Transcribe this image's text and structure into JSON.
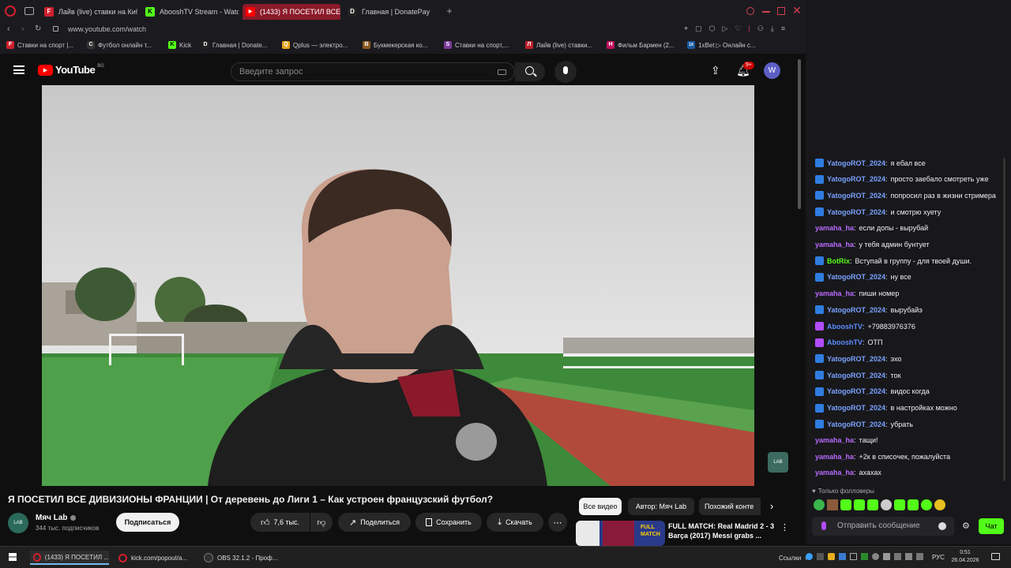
{
  "browser": {
    "tabs": [
      {
        "label": "Лайв (live) ставки на Киб",
        "icon_color": "#d0202e",
        "icon_text": "F"
      },
      {
        "label": "AbooshTV Stream - Watch",
        "icon_color": "#53fc18",
        "icon_text": "K"
      },
      {
        "label": "(1433) Я ПОСЕТИЛ ВСЕ Д",
        "icon_color": "#ff0000",
        "icon_text": "▶"
      },
      {
        "label": "Главная | DonatePay",
        "icon_color": "#222",
        "icon_text": "D"
      }
    ],
    "url": "www.youtube.com/watch",
    "bookmarks": [
      {
        "label": "Ставки на спорт |...",
        "color": "#d0202e",
        "text": "F"
      },
      {
        "label": "Футбол онлайн т...",
        "color": "#333",
        "text": "C"
      },
      {
        "label": "Kick",
        "color": "#53fc18",
        "text": "K"
      },
      {
        "label": "Главная | Donate...",
        "color": "#222",
        "text": "D"
      },
      {
        "label": "Qplus — электро...",
        "color": "#e8a21a",
        "text": "Q"
      },
      {
        "label": "Букмекерская ко...",
        "color": "#8a5a20",
        "text": "B"
      },
      {
        "label": "Ставки на спорт,...",
        "color": "#7a3a9a",
        "text": "S"
      },
      {
        "label": "Лайв (live) ставки...",
        "color": "#c0202e",
        "text": "Л"
      },
      {
        "label": "Фильм Бармен (2...",
        "color": "#c01060",
        "text": "H"
      },
      {
        "label": "1xBet ▷ Онлайн с...",
        "color": "#1a5aa0",
        "text": "1X"
      }
    ]
  },
  "youtube": {
    "logo": "YouTube",
    "region": "BG",
    "search_placeholder": "Введите запрос",
    "notifications": "9+",
    "avatar_letter": "W",
    "video_title": "Я ПОСЕТИЛ ВСЕ ДИВИЗИОНЫ ФРАНЦИИ | От деревень до Лиги 1 – Как устроен французский футбол?",
    "channel": "Мяч Lab",
    "channel_logo": "LAB",
    "subscribers": "344 тыс. подписчиков",
    "subscribe": "Подписаться",
    "likes": "7,6 тыс.",
    "share": "Поделиться",
    "save": "Сохранить",
    "download": "Скачать",
    "chips": [
      "Все видео",
      "Автор: Мяч Lab",
      "Похожий конте"
    ],
    "rec_title_1": "FULL MATCH: Real Madrid 2 - 3",
    "rec_title_2": "Barça (2017) Messi grabs ...",
    "rec_thumb_text": "FULL MATCH"
  },
  "chat": {
    "messages": [
      {
        "user": "YatogoROT_2024",
        "text": "я ебал все",
        "color": "#7aa2ff",
        "badge": "#2f7de1"
      },
      {
        "user": "YatogoROT_2024",
        "text": "просто заебало смотреть уже",
        "color": "#7aa2ff",
        "badge": "#2f7de1"
      },
      {
        "user": "YatogoROT_2024",
        "text": "попросил раз в жизни стримера",
        "color": "#7aa2ff",
        "badge": "#2f7de1"
      },
      {
        "user": "YatogoROT_2024",
        "text": "и смотрю хуету",
        "color": "#7aa2ff",
        "badge": "#2f7de1"
      },
      {
        "user": "yamaha_ha",
        "text": "если допы - вырубай",
        "color": "#b86bff",
        "badge": ""
      },
      {
        "user": "yamaha_ha",
        "text": "у тебя админ бунтует",
        "color": "#b86bff",
        "badge": ""
      },
      {
        "user": "BotRix",
        "text": "Вступай в группу - для твоей души.",
        "color": "#53fc18",
        "badge": "#2f7de1"
      },
      {
        "user": "YatogoROT_2024",
        "text": "ну все",
        "color": "#7aa2ff",
        "badge": "#2f7de1"
      },
      {
        "user": "yamaha_ha",
        "text": "пиши номер",
        "color": "#b86bff",
        "badge": ""
      },
      {
        "user": "YatogoROT_2024",
        "text": "вырубайэ",
        "color": "#7aa2ff",
        "badge": "#2f7de1"
      },
      {
        "user": "AbooshTV",
        "text": "+79883976376",
        "color": "#5a8cff",
        "badge": "#b24cff"
      },
      {
        "user": "AbooshTV",
        "text": "ОТП",
        "color": "#5a8cff",
        "badge": "#b24cff"
      },
      {
        "user": "YatogoROT_2024",
        "text": "эхо",
        "color": "#7aa2ff",
        "badge": "#2f7de1"
      },
      {
        "user": "YatogoROT_2024",
        "text": "ток",
        "color": "#7aa2ff",
        "badge": "#2f7de1"
      },
      {
        "user": "YatogoROT_2024",
        "text": "видос когда",
        "color": "#7aa2ff",
        "badge": "#2f7de1"
      },
      {
        "user": "YatogoROT_2024",
        "text": "в настройках можно",
        "color": "#7aa2ff",
        "badge": "#2f7de1"
      },
      {
        "user": "YatogoROT_2024",
        "text": "убрать",
        "color": "#7aa2ff",
        "badge": "#2f7de1"
      },
      {
        "user": "yamaha_ha",
        "text": "тащи!",
        "color": "#b86bff",
        "badge": ""
      },
      {
        "user": "yamaha_ha",
        "text": "+2к в списочек, пожалуйста",
        "color": "#b86bff",
        "badge": ""
      },
      {
        "user": "yamaha_ha",
        "text": "ахахах",
        "color": "#b86bff",
        "badge": ""
      }
    ],
    "followers_only": "Только фолловеры",
    "input_placeholder": "Отправить сообщение",
    "send_label": "Чат"
  },
  "taskbar": {
    "items": [
      {
        "label": "(1433) Я ПОСЕТИЛ ..."
      },
      {
        "label": "kick.com/popout/a..."
      },
      {
        "label": "OBS 32.1.2 - Проф..."
      }
    ],
    "links": "Ссылки",
    "lang": "РУС",
    "time": "0:51",
    "date": "26.04.2026"
  }
}
